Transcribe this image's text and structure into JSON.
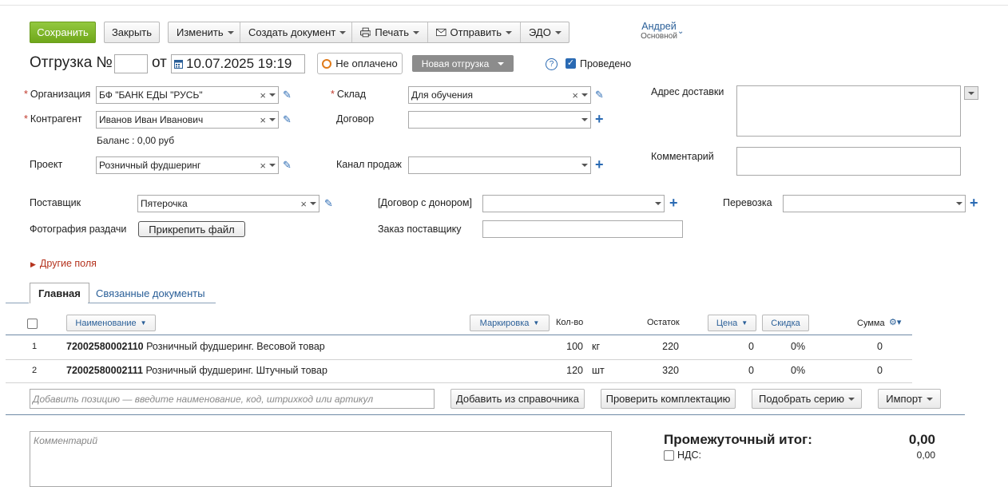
{
  "toolbar": {
    "save": "Сохранить",
    "close": "Закрыть",
    "edit": "Изменить",
    "create_doc": "Создать документ",
    "print": "Печать",
    "send": "Отправить",
    "edo": "ЭДО"
  },
  "user": {
    "name": "Андрей",
    "role": "Основной"
  },
  "header": {
    "title": "Отгрузка №",
    "number": "",
    "from": "от",
    "date": "10.07.2025 19:19",
    "payment_status": "Не оплачено",
    "status": "Новая отгрузка",
    "help": "?",
    "posted_label": "Проведено",
    "posted": true
  },
  "form": {
    "org_label": "Организация",
    "org_value": "БФ \"БАНК ЕДЫ \"РУСЬ\"",
    "counterparty_label": "Контрагент",
    "counterparty_value": "Иванов Иван Иванович",
    "balance": "Баланс : 0,00 руб",
    "project_label": "Проект",
    "project_value": "Розничный фудшеринг",
    "warehouse_label": "Склад",
    "warehouse_value": "Для обучения",
    "contract_label": "Договор",
    "contract_value": "",
    "channel_label": "Канал продаж",
    "channel_value": "",
    "delivery_label": "Адрес доставки",
    "comment_label": "Комментарий",
    "supplier_label": "Поставщик",
    "supplier_value": "Пятерочка",
    "donor_contract_label": "[Договор с донором]",
    "transport_label": "Перевозка",
    "photo_label": "Фотография раздачи",
    "attach_button": "Прикрепить файл",
    "supplier_order_label": "Заказ поставщику",
    "other_fields": "Другие поля"
  },
  "tabs": [
    {
      "label": "Главная",
      "active": true
    },
    {
      "label": "Связанные документы",
      "active": false
    }
  ],
  "table": {
    "headers": {
      "name": "Наименование",
      "marking": "Маркировка",
      "qty": "Кол-во",
      "stock": "Остаток",
      "price": "Цена",
      "discount": "Скидка",
      "sum": "Сумма"
    },
    "rows": [
      {
        "num": "1",
        "code": "72002580002110",
        "name": "Розничный фудшеринг. Весовой товар",
        "qty": "100",
        "unit": "кг",
        "stock": "220",
        "price": "0",
        "discount": "0%",
        "sum": "0"
      },
      {
        "num": "2",
        "code": "72002580002111",
        "name": "Розничный фудшеринг. Штучный товар",
        "qty": "120",
        "unit": "шт",
        "stock": "320",
        "price": "0",
        "discount": "0%",
        "sum": "0"
      }
    ]
  },
  "add_row": {
    "placeholder": "Добавить позицию — введите наименование, код, штрихкод или артикул",
    "from_catalog": "Добавить из справочника",
    "check_set": "Проверить комплектацию",
    "pick_series": "Подобрать серию",
    "import": "Импорт"
  },
  "footer": {
    "comment_placeholder": "Комментарий",
    "subtotal_label": "Промежуточный итог:",
    "subtotal_value": "0,00",
    "vat_label": "НДС:",
    "vat_value": "0,00"
  },
  "colors": {
    "accent": "#7ab42c",
    "link": "#2a5f98",
    "status": "#8c8c8c"
  }
}
